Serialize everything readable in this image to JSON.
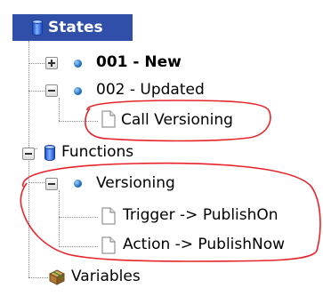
{
  "tree": {
    "states": {
      "label": "States",
      "icon": "database-icon",
      "expanded": true,
      "selected": true,
      "children": [
        {
          "label": "001 - New",
          "icon": "dot-icon",
          "expanded": false,
          "bold": true
        },
        {
          "label": "002 - Updated",
          "icon": "dot-icon",
          "expanded": true,
          "children": [
            {
              "label": "Call Versioning",
              "icon": "document-icon"
            }
          ]
        }
      ]
    },
    "functions": {
      "label": "Functions",
      "icon": "database-icon",
      "expanded": true,
      "children": [
        {
          "label": "Versioning",
          "icon": "dot-icon",
          "expanded": true,
          "children": [
            {
              "label": "Trigger -> PublishOn",
              "icon": "document-icon"
            },
            {
              "label": "Action -> PublishNow",
              "icon": "document-icon"
            }
          ]
        }
      ]
    },
    "variables": {
      "label": "Variables",
      "icon": "box-icon"
    }
  },
  "colors": {
    "selection": "#2f4fa8",
    "annotation": "#e8232b"
  }
}
